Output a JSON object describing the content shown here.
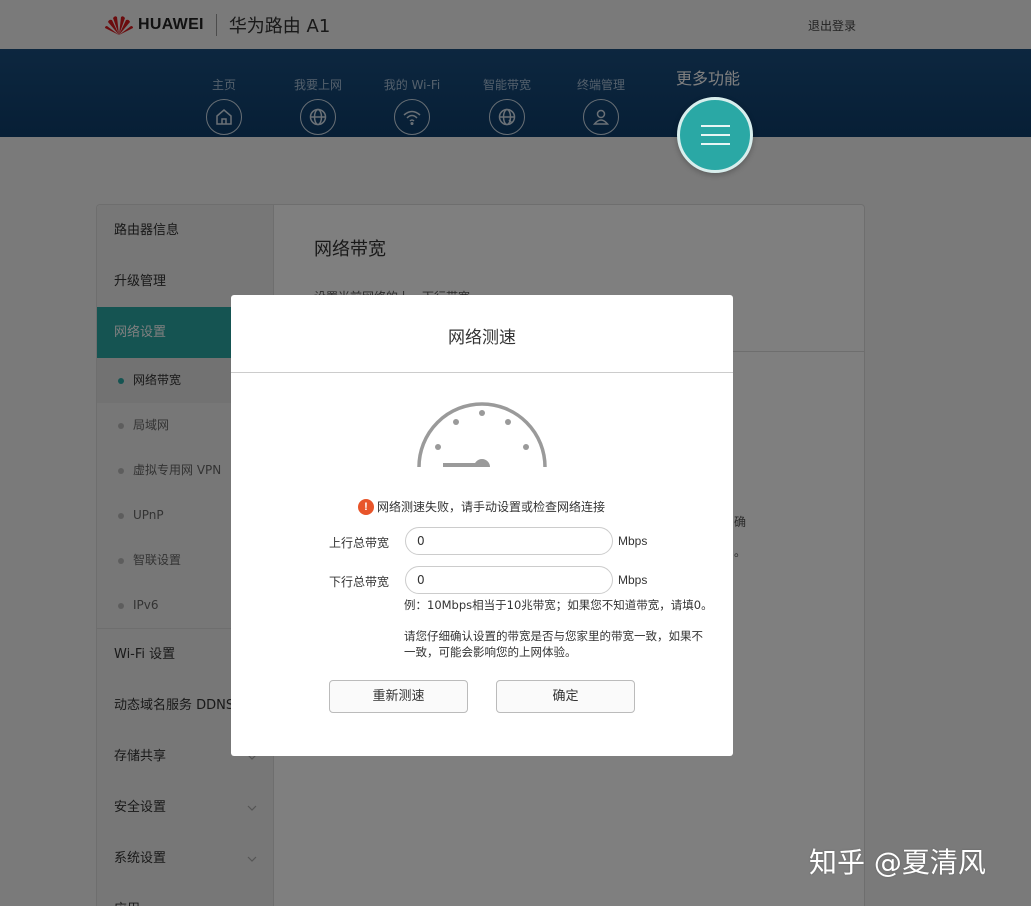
{
  "header": {
    "brand": "HUAWEI",
    "product": "华为路由 A1",
    "logout": "退出登录"
  },
  "nav": {
    "items": [
      {
        "label": "主页",
        "icon": "home-icon"
      },
      {
        "label": "我要上网",
        "icon": "globe-icon"
      },
      {
        "label": "我的 Wi-Fi",
        "icon": "wifi-icon"
      },
      {
        "label": "智能带宽",
        "icon": "bandwidth-icon"
      },
      {
        "label": "终端管理",
        "icon": "user-icon"
      }
    ],
    "more_label": "更多功能",
    "more_icon": "menu-icon"
  },
  "sidebar": {
    "items": [
      {
        "label": "路由器信息"
      },
      {
        "label": "升级管理"
      },
      {
        "label": "网络设置",
        "active": true
      },
      {
        "label": "Wi-Fi 设置"
      },
      {
        "label": "动态域名服务 DDNS"
      },
      {
        "label": "存储共享"
      },
      {
        "label": "安全设置"
      },
      {
        "label": "系统设置"
      },
      {
        "label": "应用"
      }
    ],
    "subitems": [
      {
        "label": "网络带宽",
        "active": true
      },
      {
        "label": "局域网"
      },
      {
        "label": "虚拟专用网 VPN"
      },
      {
        "label": "UPnP"
      },
      {
        "label": "智联设置"
      },
      {
        "label": "IPv6"
      }
    ]
  },
  "content": {
    "title": "网络带宽",
    "desc": "设置当前网络的上、下行带宽",
    "frag1": "确",
    "frag2": "。"
  },
  "dialog": {
    "title": "网络测速",
    "error": "网络测速失败，请手动设置或检查网络连接",
    "upload_label": "上行总带宽",
    "upload_value": "0",
    "download_label": "下行总带宽",
    "download_value": "0",
    "unit": "Mbps",
    "hint1": "例：10Mbps相当于10兆带宽；如果您不知道带宽，请填0。",
    "hint2": "请您仔细确认设置的带宽是否与您家里的带宽一致，如果不一致，可能会影响您的上网体验。",
    "retest_button": "重新测速",
    "confirm_button": "确定"
  },
  "watermark": "知乎 @夏清风",
  "colors": {
    "accent": "#2aa8a5",
    "nav_bg": "#154670",
    "warning": "#e8552a"
  }
}
